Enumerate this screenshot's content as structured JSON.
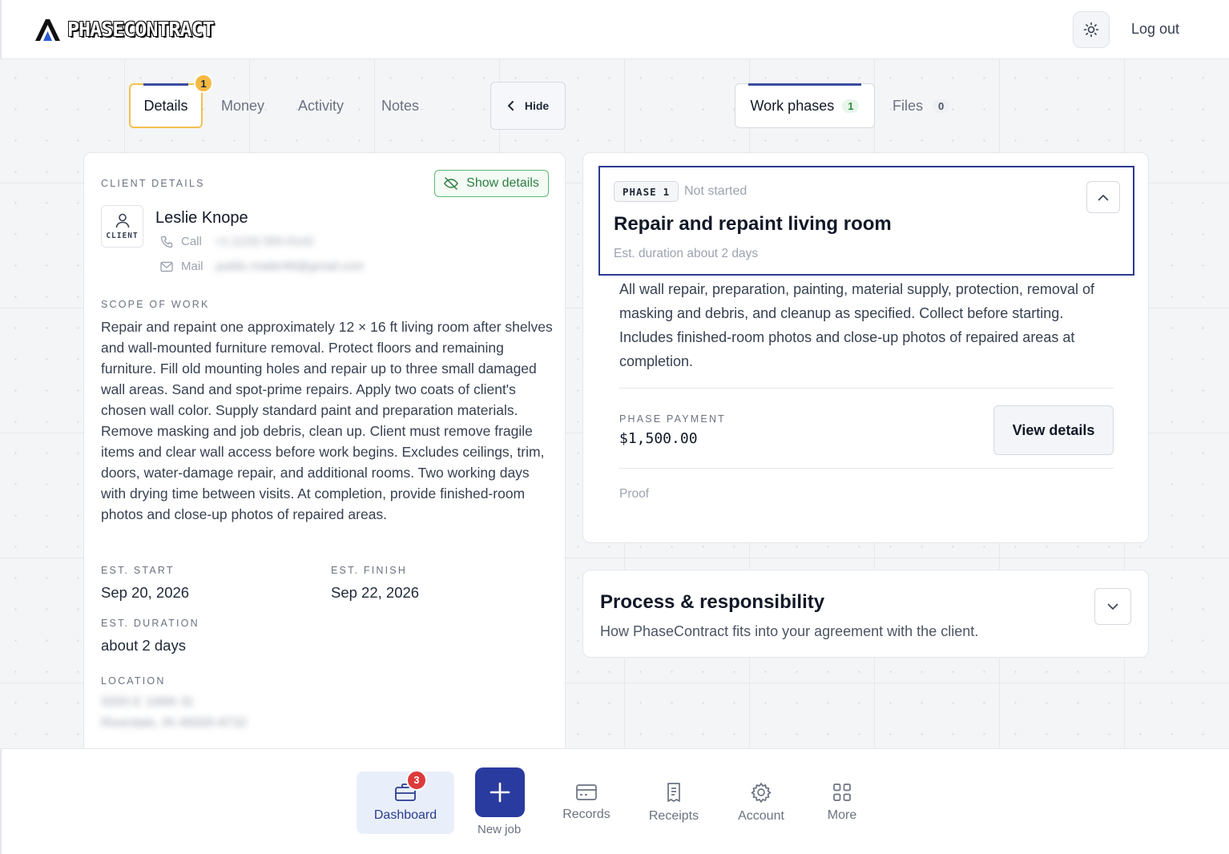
{
  "app": {
    "brand": "PHASECONTRACT",
    "logout_label": "Log out"
  },
  "left_tabs": [
    {
      "label": "Details",
      "badge": "1",
      "active": true
    },
    {
      "label": "Money"
    },
    {
      "label": "Activity"
    },
    {
      "label": "Notes"
    }
  ],
  "hide_label": "Hide",
  "right_tabs": [
    {
      "label": "Work phases",
      "count": "1",
      "active": true
    },
    {
      "label": "Files",
      "count": "0"
    }
  ],
  "client": {
    "section_label": "CLIENT DETAILS",
    "show_details_label": "Show details",
    "avatar_caption": "CLIENT",
    "name": "Leslie Knope",
    "call_label": "Call",
    "call_value": "+1 (123) 555-0142",
    "mail_label": "Mail",
    "mail_value": "public.mailer99@gmail.com"
  },
  "scope": {
    "label": "SCOPE OF WORK",
    "text": "Repair and repaint one approximately 12 × 16 ft living room after shelves and wall-mounted furniture removal. Protect floors and remaining furniture. Fill old mounting holes and repair up to three small damaged wall areas. Sand and spot-prime repairs. Apply two coats of client's chosen wall color. Supply standard paint and preparation materials. Remove masking and job debris, clean up. Client must remove fragile items and clear wall access before work begins. Excludes ceilings, trim, doors, water-damage repair, and additional rooms. Two working days with drying time between visits. At completion, provide finished-room photos and close-up photos of repaired areas."
  },
  "dates": {
    "start_label": "EST. START",
    "start_value": "Sep 20, 2026",
    "finish_label": "EST. FINISH",
    "finish_value": "Sep 22, 2026",
    "duration_label": "EST. DURATION",
    "duration_value": "about 2 days"
  },
  "location": {
    "label": "LOCATION",
    "line1": "5000 E 106th St",
    "line2": "Riverdale, IN 46000-8732"
  },
  "phase": {
    "chip_label": "PHASE",
    "chip_number": "1",
    "status": "Not started",
    "title": "Repair and repaint living room",
    "duration": "Est. duration about 2 days",
    "description": "All wall repair, preparation, painting, material supply, protection, removal of masking and debris, and cleanup as specified. Collect before starting. Includes finished-room photos and close-up photos of repaired areas at completion.",
    "payment_label": "PHASE PAYMENT",
    "payment_value": "$1,500.00",
    "view_details_label": "View details",
    "proof_label": "Proof"
  },
  "process": {
    "title": "Process & responsibility",
    "subtitle": "How PhaseContract fits into your agreement with the client."
  },
  "bottom_nav": {
    "dashboard": "Dashboard",
    "dashboard_badge": "3",
    "new_job": "New job",
    "records": "Records",
    "receipts": "Receipts",
    "account": "Account",
    "more": "More"
  },
  "colors": {
    "accent": "#2a3ba0",
    "tab_highlight": "#f2c14e",
    "success": "#2e7d42",
    "badge_red": "#dc3b3b"
  }
}
